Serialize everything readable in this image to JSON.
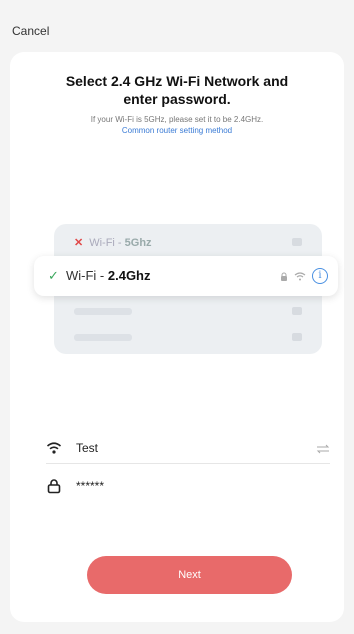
{
  "header": {
    "cancel_label": "Cancel"
  },
  "content": {
    "title": "Select 2.4 GHz Wi-Fi Network and\nenter password.",
    "subtitle": "If your Wi-Fi is 5GHz, please set it to be 2.4GHz.",
    "link_label": "Common router setting method"
  },
  "illustration": {
    "network_5g": {
      "prefix": "Wi-Fi - ",
      "band": "5Ghz",
      "status_icon": "x-mark-icon",
      "status_color": "#e04848"
    },
    "network_24g": {
      "prefix": "Wi-Fi - ",
      "band": "2.4Ghz",
      "status_icon": "check-icon",
      "status_color": "#3aa75c"
    }
  },
  "form": {
    "ssid_value": "Test",
    "password_value": "******"
  },
  "actions": {
    "next_label": "Next",
    "accent": "#e86a6a"
  }
}
